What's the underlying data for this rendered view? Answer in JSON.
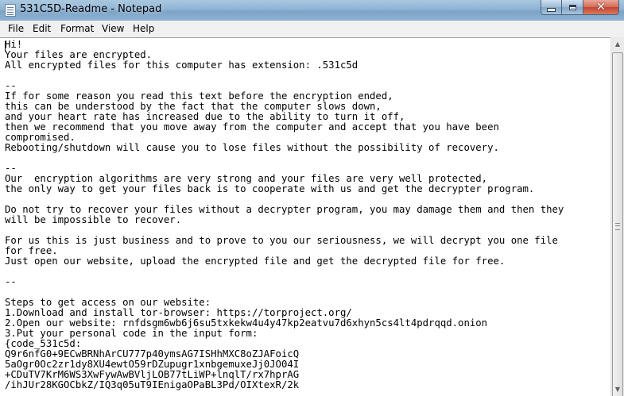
{
  "window": {
    "title": "531C5D-Readme - Notepad",
    "icon": "notepad-icon",
    "buttons": [
      "minimize-icon",
      "maximize-icon",
      "close-icon"
    ]
  },
  "menu": {
    "items": [
      "File",
      "Edit",
      "Format",
      "View",
      "Help"
    ]
  },
  "document": {
    "lines": [
      "Hi!",
      "Your files are encrypted.",
      "All encrypted files for this computer has extension: .531c5d",
      "",
      "--",
      "If for some reason you read this text before the encryption ended,",
      "this can be understood by the fact that the computer slows down,",
      "and your heart rate has increased due to the ability to turn it off,",
      "then we recommend that you move away from the computer and accept that you have been",
      "compromised.",
      "Rebooting/shutdown will cause you to lose files without the possibility of recovery.",
      "",
      "--",
      "Our  encryption algorithms are very strong and your files are very well protected,",
      "the only way to get your files back is to cooperate with us and get the decrypter program.",
      "",
      "Do not try to recover your files without a decrypter program, you may damage them and then they",
      "will be impossible to recover.",
      "",
      "For us this is just business and to prove to you our seriousness, we will decrypt you one file",
      "for free.",
      "Just open our website, upload the encrypted file and get the decrypted file for free.",
      "",
      "--",
      "",
      "Steps to get access on our website:",
      "1.Download and install tor-browser: https://torproject.org/",
      "2.Open our website: rnfdsgm6wb6j6su5txkekw4u4y47kp2eatvu7d6xhyn5cs4lt4pdrqqd.onion",
      "3.Put your personal code in the input form:",
      "{code_531c5d:",
      "Q9r6nfG0+9ECwBRNhArCU777p40ymsAG7ISHhMXC8oZJAFoicQ",
      "5aOgr0Oc2zr1dy8XU4ewtO59rDZupugr1xnbgemuxeJj0JO04I",
      "+CDuTV7KrM6WS3XwFywAwBVljLOB77tLiWP+lnqlT/rx7hprAG",
      "/ihJUr28KGOCbkZ/IQ3q05uT9IEnigaOPaBL3Pd/OIXtexR/2k"
    ]
  },
  "scrollbar": {
    "up_icon": "scroll-up-arrow-icon",
    "down_icon": "scroll-down-arrow-icon"
  }
}
